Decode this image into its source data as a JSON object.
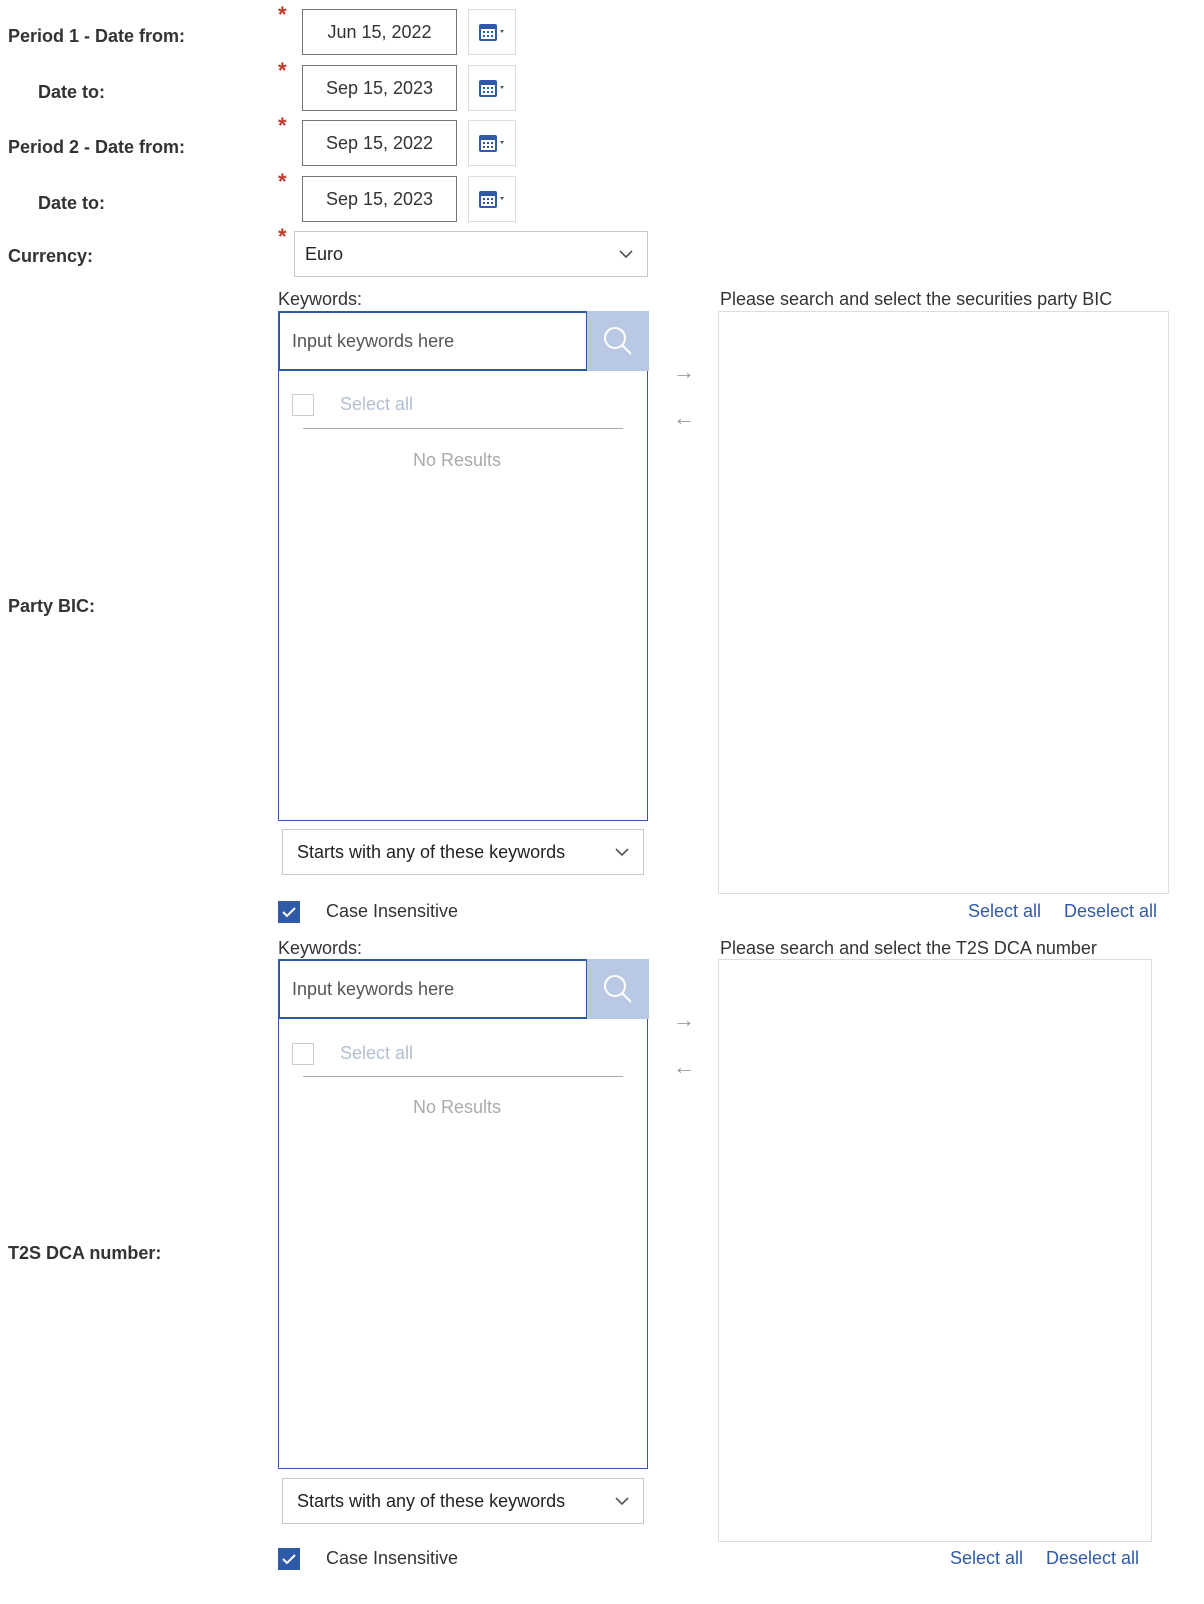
{
  "fields": {
    "period1_from_label": "Period 1 - Date from:",
    "period1_to_label": "Date to:",
    "period2_from_label": "Period 2 - Date from:",
    "period2_to_label": "Date to:",
    "currency_label": "Currency:",
    "party_bic_label": "Party BIC:",
    "t2s_dca_label": "T2S DCA number:"
  },
  "required_marker": "*",
  "dates": {
    "period1_from": "Jun 15, 2022",
    "period1_to": "Sep 15, 2023",
    "period2_from": "Sep 15, 2022",
    "period2_to": "Sep 15, 2023"
  },
  "currency": {
    "selected": "Euro"
  },
  "party_bic": {
    "keywords_label": "Keywords:",
    "search_placeholder": "Input keywords here",
    "select_all": "Select all",
    "no_results": "No Results",
    "match_mode": "Starts with any of these keywords",
    "case_insensitive_label": "Case Insensitive",
    "case_insensitive_checked": true,
    "right_title": "Please search and select the securities party BIC",
    "right_select_all": "Select all",
    "right_deselect_all": "Deselect all"
  },
  "t2s_dca": {
    "keywords_label": "Keywords:",
    "search_placeholder": "Input keywords here",
    "select_all": "Select all",
    "no_results": "No Results",
    "match_mode": "Starts with any of these keywords",
    "case_insensitive_label": "Case Insensitive",
    "case_insensitive_checked": true,
    "right_title": "Please search and select the T2S DCA number",
    "right_select_all": "Select all",
    "right_deselect_all": "Deselect all"
  },
  "arrows": {
    "move_right": "→",
    "move_left": "←"
  },
  "colors": {
    "accent": "#2f5aa8",
    "required": "#c0392b",
    "search_button": "#b9c9e4"
  }
}
